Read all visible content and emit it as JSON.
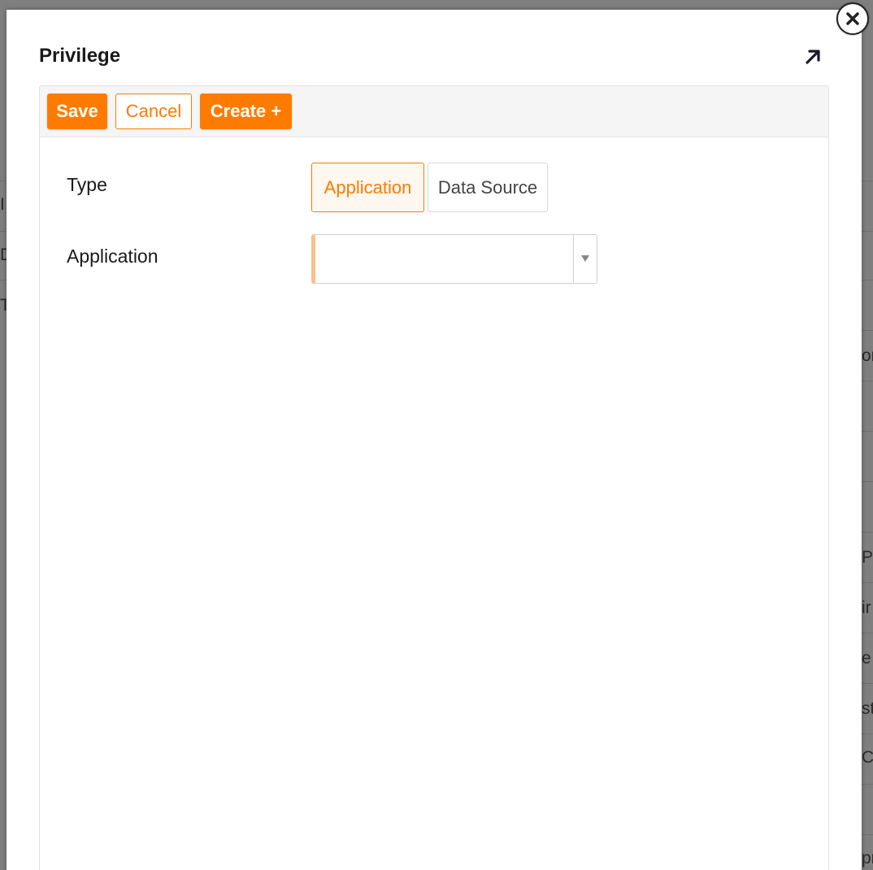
{
  "background": {
    "right_fragments": [
      "",
      "",
      "",
      "",
      "om",
      "",
      "",
      "Pl",
      "ir",
      "e",
      "st",
      "C",
      "",
      "pr"
    ],
    "left_fragments": [
      "I",
      "D",
      "T"
    ]
  },
  "modal": {
    "title": "Privilege",
    "toolbar": {
      "save_label": "Save",
      "cancel_label": "Cancel",
      "create_label": "Create +"
    },
    "form": {
      "type_label": "Type",
      "type_options": [
        "Application",
        "Data Source"
      ],
      "type_selected": "Application",
      "application_label": "Application",
      "application_value": ""
    }
  },
  "icons": {
    "expand": "arrow-up-right-icon",
    "close": "close-icon",
    "dropdown": "caret-down-icon"
  },
  "colors": {
    "accent": "#ff7b00",
    "accent_light": "#fff7f0",
    "required_marker": "#f8c08a"
  }
}
